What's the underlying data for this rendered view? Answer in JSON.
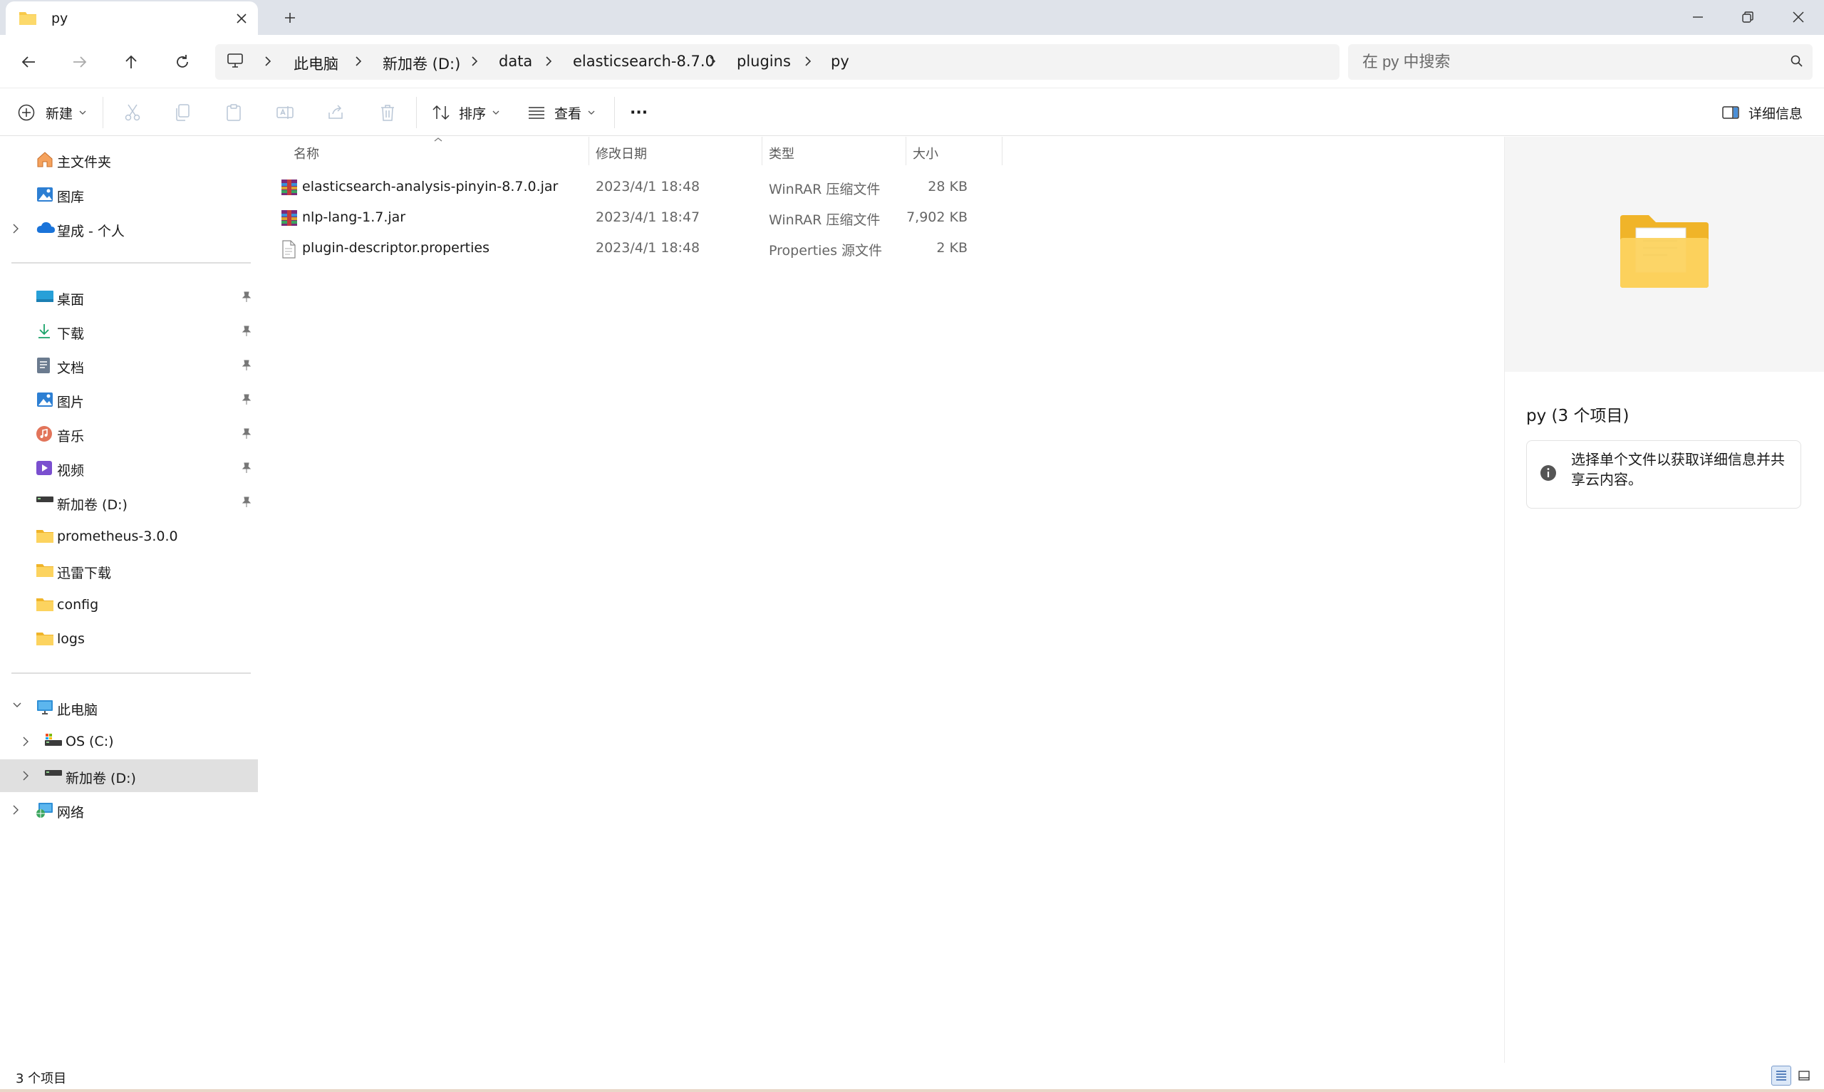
{
  "tab": {
    "title": "py",
    "new_tab": "+"
  },
  "window": {
    "minimize": "minimize",
    "maximize": "restore",
    "close": "close"
  },
  "address": {
    "breadcrumbs": [
      "此电脑",
      "新加卷 (D:)",
      "data",
      "elasticsearch-8.7.0",
      "plugins",
      "py"
    ]
  },
  "search": {
    "placeholder": "在 py 中搜索",
    "value": ""
  },
  "toolbar": {
    "new_label": "新建",
    "sort_label": "排序",
    "view_label": "查看",
    "more_label": "···",
    "details_label": "详细信息"
  },
  "sidebar": {
    "quick": [
      {
        "label": "主文件夹",
        "icon": "home-icon"
      },
      {
        "label": "图库",
        "icon": "gallery-icon"
      },
      {
        "label": "望成 - 个人",
        "icon": "onedrive-icon"
      }
    ],
    "pinned": [
      {
        "label": "桌面",
        "icon": "desktop-icon"
      },
      {
        "label": "下载",
        "icon": "download-icon"
      },
      {
        "label": "文档",
        "icon": "documents-icon"
      },
      {
        "label": "图片",
        "icon": "pictures-icon"
      },
      {
        "label": "音乐",
        "icon": "music-icon"
      },
      {
        "label": "视频",
        "icon": "videos-icon"
      },
      {
        "label": "新加卷 (D:)",
        "icon": "drive-icon"
      },
      {
        "label": "prometheus-3.0.0",
        "icon": "folder-icon"
      },
      {
        "label": "迅雷下载",
        "icon": "folder-icon"
      },
      {
        "label": "config",
        "icon": "folder-icon"
      },
      {
        "label": "logs",
        "icon": "folder-icon"
      }
    ],
    "tree": [
      {
        "label": "此电脑",
        "icon": "pc-icon"
      },
      {
        "label": "OS (C:)",
        "icon": "drive-c-icon"
      },
      {
        "label": "新加卷 (D:)",
        "icon": "drive-icon"
      },
      {
        "label": "网络",
        "icon": "network-icon"
      }
    ]
  },
  "columns": {
    "name": "名称",
    "date": "修改日期",
    "type": "类型",
    "size": "大小"
  },
  "files": [
    {
      "name": "elasticsearch-analysis-pinyin-8.7.0.jar",
      "date": "2023/4/1 18:48",
      "type": "WinRAR 压缩文件",
      "size": "28 KB",
      "icon": "winrar-icon"
    },
    {
      "name": "nlp-lang-1.7.jar",
      "date": "2023/4/1 18:47",
      "type": "WinRAR 压缩文件",
      "size": "7,902 KB",
      "icon": "winrar-icon"
    },
    {
      "name": "plugin-descriptor.properties",
      "date": "2023/4/1 18:48",
      "type": "Properties 源文件",
      "size": "2 KB",
      "icon": "file-icon"
    }
  ],
  "details": {
    "title": "py (3 个项目)",
    "message": "选择单个文件以获取详细信息并共享云内容。"
  },
  "status": {
    "count": "3 个项目"
  },
  "colors": {
    "accent": "#0067c0",
    "folder": "#f8c94a",
    "selected": "#e0e0e0",
    "tabbar": "#dfe3ea"
  }
}
